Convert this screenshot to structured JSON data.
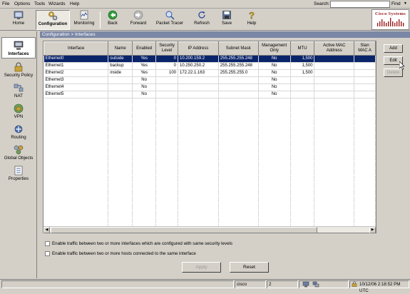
{
  "menu": {
    "file": "File",
    "options": "Options",
    "tools": "Tools",
    "wizards": "Wizards",
    "help": "Help",
    "search_label": "Search:",
    "search_value": "",
    "find_label": "Find"
  },
  "toolbar": {
    "home": "Home",
    "configuration": "Configuration",
    "monitoring": "Monitoring",
    "back": "Back",
    "forward": "Forward",
    "packet_tracer": "Packet Tracer",
    "refresh": "Refresh",
    "save": "Save",
    "help": "Help"
  },
  "logo": {
    "text": "Cisco Systems"
  },
  "nav": {
    "interfaces": "Interfaces",
    "security_policy": "Security Policy",
    "nat": "NAT",
    "vpn": "VPN",
    "routing": "Routing",
    "global_objects": "Global Objects",
    "properties": "Properties"
  },
  "breadcrumb": "Configuration > Interfaces",
  "table": {
    "headers": {
      "interface": "Interface",
      "name": "Name",
      "enabled": "Enabled",
      "security_level": "Security Level",
      "ip_address": "IP Address",
      "subnet_mask": "Subnet Mask",
      "management_only": "Management Only",
      "mtu": "MTU",
      "active_mac": "Active MAC Address",
      "standby_mac": "Stan MAC A"
    },
    "rows": [
      {
        "interface": "Ethernet0",
        "name": "outside",
        "enabled": "Yes",
        "security": "0",
        "ip": "10.200.159.2",
        "mask": "255.255.255.248",
        "mgmt": "No",
        "mtu": "1,500",
        "selected": true
      },
      {
        "interface": "Ethernet1",
        "name": "backup",
        "enabled": "Yes",
        "security": "0",
        "ip": "10.250.250.2",
        "mask": "255.255.255.248",
        "mgmt": "No",
        "mtu": "1,500",
        "selected": false
      },
      {
        "interface": "Ethernet2",
        "name": "inside",
        "enabled": "Yes",
        "security": "100",
        "ip": "172.22.1.163",
        "mask": "255.255.255.0",
        "mgmt": "No",
        "mtu": "1,500",
        "selected": false
      },
      {
        "interface": "Ethernet3",
        "name": "",
        "enabled": "No",
        "security": "",
        "ip": "",
        "mask": "",
        "mgmt": "No",
        "mtu": "",
        "selected": false
      },
      {
        "interface": "Ethernet4",
        "name": "",
        "enabled": "No",
        "security": "",
        "ip": "",
        "mask": "",
        "mgmt": "No",
        "mtu": "",
        "selected": false
      },
      {
        "interface": "Ethernet5",
        "name": "",
        "enabled": "No",
        "security": "",
        "ip": "",
        "mask": "",
        "mgmt": "No",
        "mtu": "",
        "selected": false
      }
    ]
  },
  "side_buttons": {
    "add": "Add",
    "edit": "Edit",
    "delete": "Delete"
  },
  "options": {
    "same_security": "Enable traffic between two or more interfaces which are configured with same security levels",
    "same_interface": "Enable traffic between two or more hosts connected to the same interface"
  },
  "buttons": {
    "apply": "Apply",
    "reset": "Reset"
  },
  "status": {
    "user": "cisco",
    "privilege": "2",
    "datetime": "10/12/06 2:18:52 PM UTC"
  },
  "colors": {
    "selection": "#0a246a",
    "breadcrumb_bg": "#7a87a6",
    "chrome": "#d4d0c8"
  }
}
